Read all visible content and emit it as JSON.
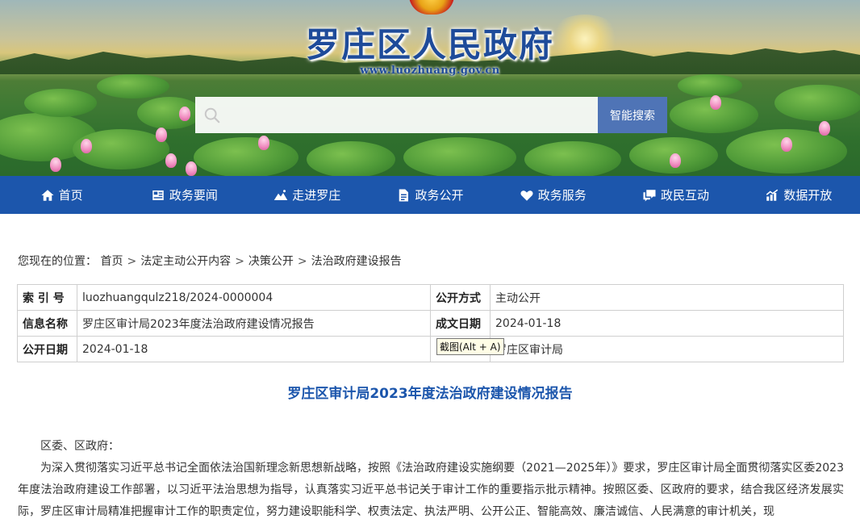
{
  "site": {
    "title": "罗庄区人民政府",
    "url": "www.luozhuang.gov.cn",
    "search_placeholder": "",
    "search_button": "智能搜索"
  },
  "nav": [
    {
      "label": "首页",
      "icon": "home-icon"
    },
    {
      "label": "政务要闻",
      "icon": "news-icon"
    },
    {
      "label": "走进罗庄",
      "icon": "landscape-icon"
    },
    {
      "label": "政务公开",
      "icon": "document-icon"
    },
    {
      "label": "政务服务",
      "icon": "heart-icon"
    },
    {
      "label": "政民互动",
      "icon": "chat-icon"
    },
    {
      "label": "数据开放",
      "icon": "chart-icon"
    }
  ],
  "breadcrumb": {
    "prefix": "您现在的位置：",
    "items": [
      "首页",
      "法定主动公开内容",
      "决策公开",
      "法治政府建设报告"
    ]
  },
  "meta": {
    "index_label": "索 引 号",
    "index_value": "luozhuangqulz218/2024-0000004",
    "open_mode_label": "公开方式",
    "open_mode_value": "主动公开",
    "info_name_label": "信息名称",
    "info_name_value": "罗庄区审计局2023年度法治政府建设情况报告",
    "doc_date_label": "成文日期",
    "doc_date_value": "2024-01-18",
    "pub_date_label": "公开日期",
    "pub_date_value": "2024-01-18",
    "publisher_label": "",
    "publisher_value": "罗庄区审计局"
  },
  "tooltip": "截图(Alt + A)",
  "article": {
    "title": "罗庄区审计局2023年度法治政府建设情况报告",
    "salutation": "区委、区政府：",
    "paragraph1": "为深入贯彻落实习近平总书记全面依法治国新理念新思想新战略，按照《法治政府建设实施纲要（2021—2025年）》要求，罗庄区审计局全面贯彻落实区委2023年度法治政府建设工作部署，以习近平法治思想为指导，认真落实习近平总书记关于审计工作的重要指示批示精神。按照区委、区政府的要求，结合我区经济发展实际，罗庄区审计局精准把握审计工作的职责定位，努力建设职能科学、权责法定、执法严明、公开公正、智能高效、廉洁诚信、人民满意的审计机关，现"
  },
  "colors": {
    "nav_bg": "#1c56ac",
    "title_blue": "#1e4b9a",
    "search_button_bg": "#4f74b6"
  }
}
